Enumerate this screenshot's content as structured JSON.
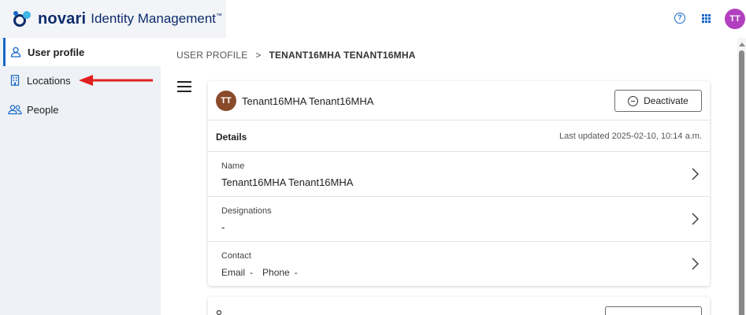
{
  "brand": {
    "word": "novari",
    "product": "Identity Management",
    "trademark": "™",
    "color": "#0d2c6c"
  },
  "header": {
    "help_icon": "help-circle-icon",
    "help_glyph": "?",
    "apps_icon": "grid-apps-icon",
    "avatar_initials": "TT",
    "avatar_color": "#b23fbf"
  },
  "sidebar": {
    "items": [
      {
        "label": "User profile",
        "icon": "user-icon",
        "active": true
      },
      {
        "label": "Locations",
        "icon": "building-icon",
        "active": false
      },
      {
        "label": "People",
        "icon": "people-icon",
        "active": false
      }
    ]
  },
  "breadcrumb": {
    "parent": "USER PROFILE",
    "separator": ">",
    "current": "TENANT16MHA TENANT16MHA"
  },
  "profile_card": {
    "avatar_initials": "TT",
    "avatar_color": "#8a4b2a",
    "name": "Tenant16MHA Tenant16MHA",
    "deactivate_label": "Deactivate",
    "details_title": "Details",
    "last_updated": "Last updated 2025-02-10, 10:14 a.m.",
    "rows": [
      {
        "label": "Name",
        "value": "Tenant16MHA Tenant16MHA"
      },
      {
        "label": "Designations",
        "value": "-"
      },
      {
        "label": "Contact",
        "email_label": "Email",
        "email_value": "-",
        "phone_label": "Phone",
        "phone_value": "-"
      }
    ]
  },
  "accent_color": "#1668c8",
  "annotation_arrow_color": "#e02020"
}
